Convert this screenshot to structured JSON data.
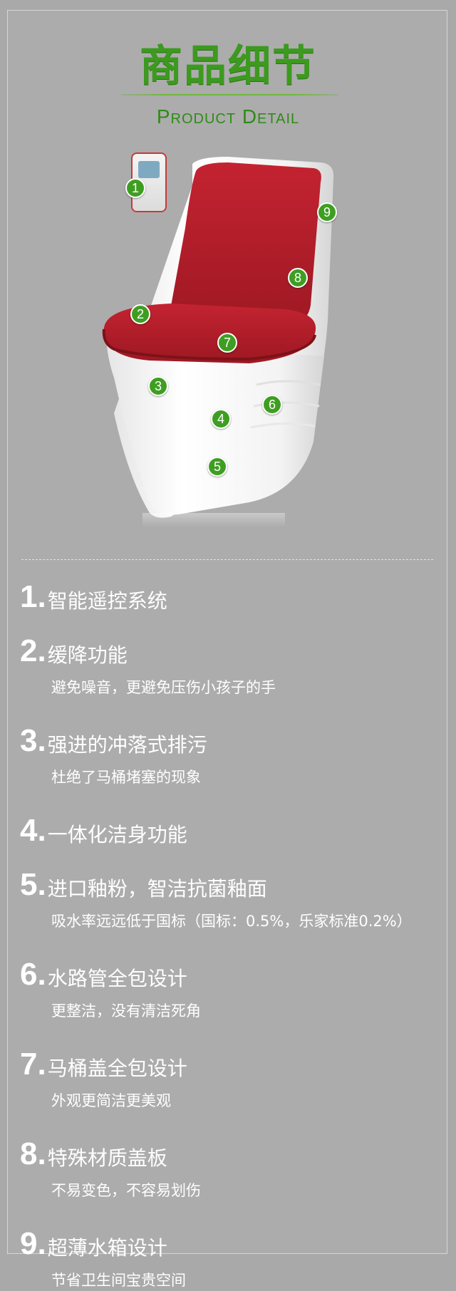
{
  "header": {
    "title_cn": "商品细节",
    "title_en": "Product Detail"
  },
  "hotspots": [
    "1",
    "2",
    "3",
    "4",
    "5",
    "6",
    "7",
    "8",
    "9"
  ],
  "features": [
    {
      "num": "1.",
      "title": "智能遥控系统",
      "desc": ""
    },
    {
      "num": "2.",
      "title": "缓降功能",
      "desc": "避免噪音，更避免压伤小孩子的手"
    },
    {
      "num": "3.",
      "title": "强进的冲落式排污",
      "desc": "杜绝了马桶堵塞的现象"
    },
    {
      "num": "4.",
      "title": "一体化洁身功能",
      "desc": ""
    },
    {
      "num": "5.",
      "title": "进口釉粉，智洁抗菌釉面",
      "desc": "吸水率远远低于国标（国标：0.5%，乐家标准0.2%）"
    },
    {
      "num": "6.",
      "title": "水路管全包设计",
      "desc": "更整洁，没有清洁死角"
    },
    {
      "num": "7.",
      "title": "马桶盖全包设计",
      "desc": "外观更简洁更美观"
    },
    {
      "num": "8.",
      "title": "特殊材质盖板",
      "desc": "不易变色，不容易划伤"
    },
    {
      "num": "9.",
      "title": "超薄水箱设计",
      "desc": "节省卫生间宝贵空间"
    }
  ],
  "colors": {
    "accent": "#3f9e22",
    "lid_red": "#b3202c",
    "background": "#acacac"
  }
}
